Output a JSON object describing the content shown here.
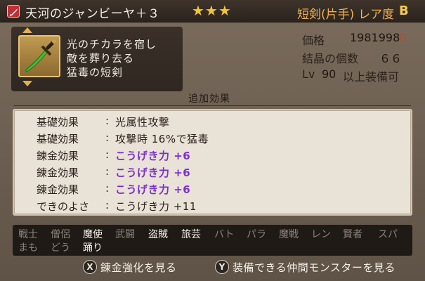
{
  "header": {
    "category_icon": "dagger-icon",
    "item_name": "天河のジャンビーヤ＋３",
    "stars": "★★★",
    "type": "短剣(片手)",
    "rarity_label": "レア度",
    "rarity_value": "B"
  },
  "item": {
    "icon": "green-dagger-icon",
    "description": [
      "光のチカラを宿し",
      "敵を葬り去る",
      "猛毒の短剣"
    ]
  },
  "stats": {
    "price_label": "価格",
    "price_value": "1981998",
    "currency": "G",
    "crystals_label": "結晶の個数",
    "crystals_value": "６６",
    "level_label": "Lv",
    "level_value": "90",
    "level_suffix": "以上装備可"
  },
  "effects": {
    "title": "追加効果",
    "rows": [
      {
        "label": "基礎効果",
        "value": "光属性攻撃"
      },
      {
        "label": "基礎効果",
        "value": "攻撃時 16%で猛毒"
      },
      {
        "label": "錬金効果",
        "value": "こうげき力 +6"
      },
      {
        "label": "錬金効果",
        "value": "こうげき力 +6"
      },
      {
        "label": "錬金効果",
        "value": "こうげき力 +6"
      },
      {
        "label": "できのよさ",
        "value": "こうげき力 +11"
      }
    ]
  },
  "jobs": [
    {
      "name": "戦士"
    },
    {
      "name": "僧侶"
    },
    {
      "name": "魔使"
    },
    {
      "name": "武闘"
    },
    {
      "name": "盗賊"
    },
    {
      "name": "旅芸"
    },
    {
      "name": "バト"
    },
    {
      "name": "パラ"
    },
    {
      "name": "魔戦"
    },
    {
      "name": "レン"
    },
    {
      "name": "賢者"
    },
    {
      "name": "スパ"
    },
    {
      "name": "まも"
    },
    {
      "name": "どう"
    },
    {
      "name": "踊り"
    }
  ],
  "footer": {
    "x_button": "X",
    "x_label": "錬金強化を見る",
    "y_button": "Y",
    "y_label": "装備できる仲間モンスターを見る"
  }
}
